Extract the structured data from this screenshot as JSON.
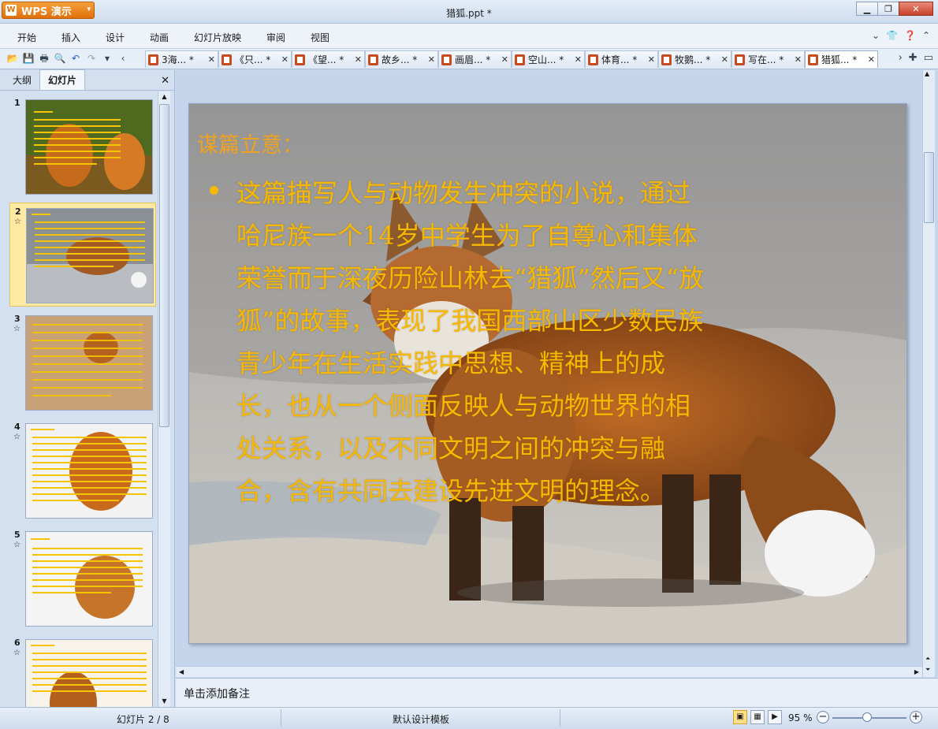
{
  "app": {
    "logo_label": "WPS 演示",
    "window_title": "猎狐.ppt *"
  },
  "menu": {
    "items": [
      "开始",
      "插入",
      "设计",
      "动画",
      "幻灯片放映",
      "审阅",
      "视图"
    ]
  },
  "doc_tabs": [
    {
      "label": "3海..."
    },
    {
      "label": "《只..."
    },
    {
      "label": "《望..."
    },
    {
      "label": "故乡..."
    },
    {
      "label": "画眉..."
    },
    {
      "label": "空山..."
    },
    {
      "label": "体育..."
    },
    {
      "label": "牧鹅..."
    },
    {
      "label": "写在..."
    },
    {
      "label": "猎狐...",
      "active": true
    }
  ],
  "tab_modified_mark": "*",
  "left_pane": {
    "tabs": [
      "大纲",
      "幻灯片"
    ],
    "active_tab": "幻灯片",
    "thumbnails": [
      {
        "num": "1",
        "star": ""
      },
      {
        "num": "2",
        "star": "☆"
      },
      {
        "num": "3",
        "star": "☆"
      },
      {
        "num": "4",
        "star": "☆"
      },
      {
        "num": "5",
        "star": "☆"
      },
      {
        "num": "6",
        "star": "☆"
      }
    ],
    "selected": "2"
  },
  "slide": {
    "title": "谋篇立意：",
    "body": "这篇描写人与动物发生冲突的小说，通过哈尼族一个14岁中学生为了自尊心和集体荣誉而于深夜历险山林去“猎狐”然后又“放狐”的故事，表现了我国西部山区少数民族青少年在生活实践中思想、精神上的成长，也从一个侧面反映人与动物世界的相处关系，以及不同文明之间的冲突与融合，含有共同去建设先进文明的理念。",
    "body_lines": [
      "这篇描写人与动物发生冲突的小说，通过",
      "哈尼族一个14岁中学生为了自尊心和集体",
      "荣誉而于深夜历险山林去“猎狐”然后又“放",
      "狐”的故事，表现了我国西部山区少数民族",
      "青少年在生活实践中思想、精神上的成",
      "长，也从一个侧面反映人与动物世界的相",
      "处关系，以及不同文明之间的冲突与融",
      "合，含有共同去建设先进文明的理念。"
    ]
  },
  "notes": {
    "placeholder": "单击添加备注"
  },
  "status": {
    "slide_indicator": "幻灯片 2 / 8",
    "template": "默认设计模板",
    "zoom": "95 %",
    "zoom_level_percent": 95
  },
  "colors": {
    "slide_text": "#f6b800",
    "slide_title": "#f0a21e",
    "wps_orange": "#e0700c"
  }
}
